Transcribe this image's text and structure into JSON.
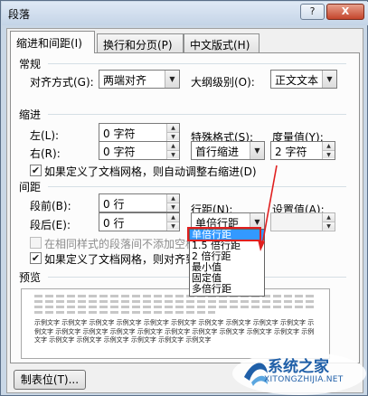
{
  "window": {
    "title": "段落",
    "help_label": "?",
    "close_label": "X"
  },
  "tabs": [
    {
      "label": "缩进和间距(I)"
    },
    {
      "label": "换行和分页(P)"
    },
    {
      "label": "中文版式(H)"
    }
  ],
  "general": {
    "section": "常规",
    "alignment_label": "对齐方式(G):",
    "alignment_value": "两端对齐",
    "outline_label": "大纲级别(O):",
    "outline_value": "正文文本"
  },
  "indent": {
    "section": "缩进",
    "left_label": "左(L):",
    "left_value": "0 字符",
    "right_label": "右(R):",
    "right_value": "0 字符",
    "special_label": "特殊格式(S):",
    "special_value": "首行缩进",
    "by_label": "度量值(Y):",
    "by_value": "2 字符",
    "grid_checkbox": "如果定义了文档网格，则自动调整右缩进(D)"
  },
  "spacing": {
    "section": "间距",
    "before_label": "段前(B):",
    "before_value": "0 行",
    "after_label": "段后(E):",
    "after_value": "0 行",
    "line_label": "行距(N):",
    "line_value": "单倍行距",
    "at_label": "设置值(A):",
    "at_value": "",
    "no_space_checkbox": "在相同样式的段落间不添加空格(C)",
    "grid_checkbox": "如果定义了文档网格，则对齐到网格(W)",
    "line_options": [
      "单倍行距",
      "1.5 倍行距",
      "2 倍行距",
      "最小值",
      "固定值",
      "多倍行距"
    ]
  },
  "preview": {
    "section": "预览",
    "sample_text": "示例文字 示例文字 示例文字 示例文字 示例文字 示例文字 示例文字 示例文字 示例文字 示例文字 示例文字 示例文字 示例文字 示例文字 示例文字 示例文字 示例文字 示例文字 示例文字 示例文字 示例文字 示例文字 示例文字 示例文字 示例文字 示例文字 示例文字"
  },
  "buttons": {
    "tabs_button": "制表位(T)..."
  },
  "watermark": {
    "title": "系统之家",
    "url": "XITONGZHIJIA.NET"
  },
  "colors": {
    "accent": "#3399ff",
    "highlight": "#e02020",
    "watermark": "#1f5fa8"
  }
}
